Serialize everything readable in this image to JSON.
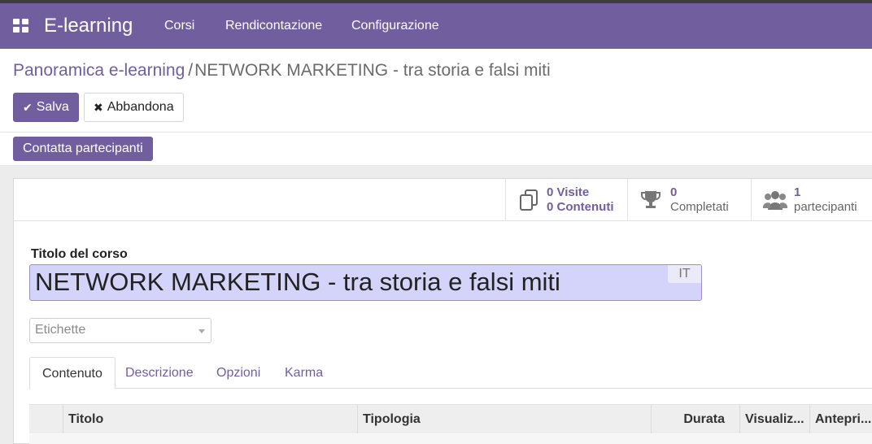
{
  "navbar": {
    "apps_icon": "grid-icon",
    "brand": "E-learning",
    "menu": [
      {
        "label": "Corsi"
      },
      {
        "label": "Rendicontazione"
      },
      {
        "label": "Configurazione"
      }
    ],
    "accent": "#715e9e"
  },
  "breadcrumb": {
    "parent": "Panoramica e-learning",
    "separator": "/",
    "current": "NETWORK MARKETING - tra storia e falsi miti"
  },
  "actions": {
    "save": {
      "label": "Salva",
      "icon": "check-icon"
    },
    "discard": {
      "label": "Abbandona",
      "icon": "times-icon"
    },
    "contact": {
      "label": "Contatta partecipanti"
    }
  },
  "stats": [
    {
      "icon": "copy-icon",
      "line1": "0 Visite",
      "line2": "0 Contenuti"
    },
    {
      "icon": "trophy-icon",
      "line1": "0",
      "line2": "Completati"
    },
    {
      "icon": "users-icon",
      "line1": "1",
      "line2": "partecipanti"
    }
  ],
  "form": {
    "title_label": "Titolo del corso",
    "title_value": "NETWORK MARKETING - tra storia e falsi miti",
    "lang": "IT",
    "tags_placeholder": "Etichette"
  },
  "tabs": [
    {
      "label": "Contenuto",
      "active": true
    },
    {
      "label": "Descrizione",
      "active": false
    },
    {
      "label": "Opzioni",
      "active": false
    },
    {
      "label": "Karma",
      "active": false
    }
  ],
  "table": {
    "columns": [
      {
        "label": "Titolo"
      },
      {
        "label": "Tipologia"
      },
      {
        "label": "Durata"
      },
      {
        "label": "Visualiz..."
      },
      {
        "label": "Antepri..."
      }
    ]
  }
}
